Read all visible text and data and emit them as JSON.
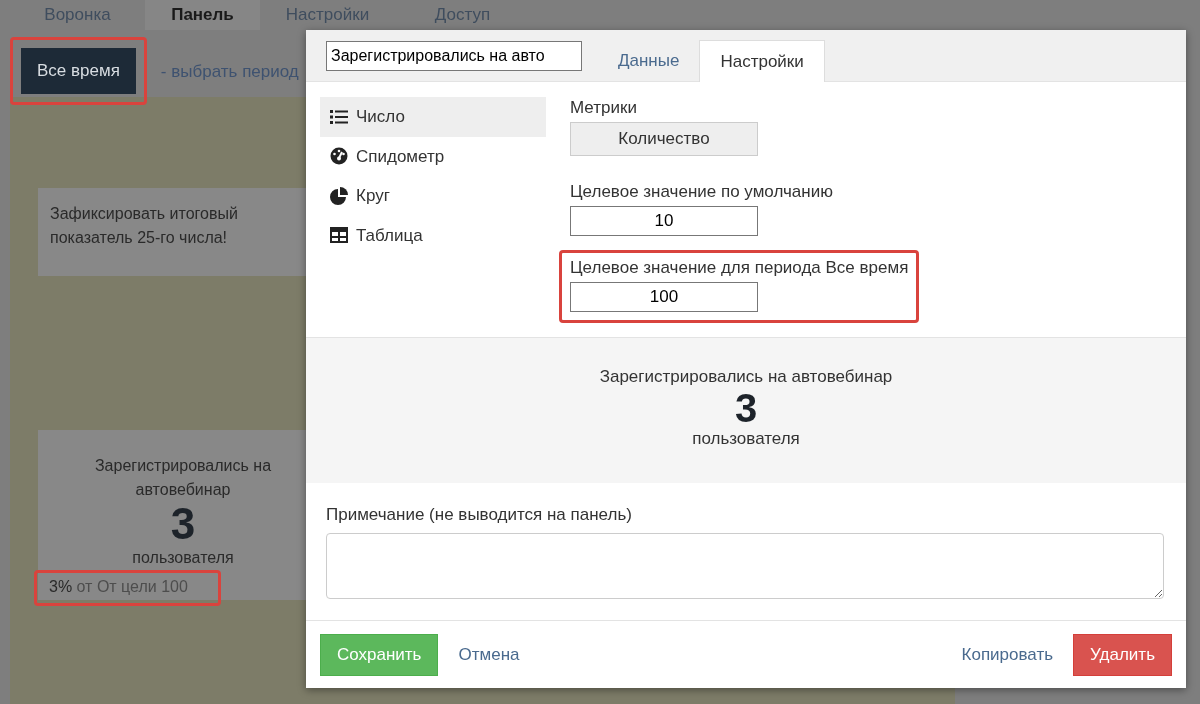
{
  "page_tabs": [
    {
      "label": "Воронка",
      "selected": false
    },
    {
      "label": "Панель",
      "selected": true
    },
    {
      "label": "Настройки",
      "selected": false
    },
    {
      "label": "Доступ",
      "selected": false
    }
  ],
  "period_button": {
    "label": "Все время",
    "highlighted": true
  },
  "period_link": "- выбрать период",
  "note_card": {
    "text": "Зафиксировать итоговый показатель 25-го числа!"
  },
  "metric_card": {
    "title": "Зарегистрировались на автовебинар",
    "value": "3",
    "unit": "пользователя",
    "progress": "**3%** от От цели 100",
    "highlighted": true
  },
  "modal": {
    "title_value": "Зарегистрировались на авто",
    "tabs": [
      {
        "label": "Данные",
        "selected": false
      },
      {
        "label": "Настройки",
        "selected": true
      }
    ],
    "widget_types": [
      {
        "label": "Число",
        "selected": true
      },
      {
        "label": "Спидометр",
        "selected": false
      },
      {
        "label": "Круг",
        "selected": false
      },
      {
        "label": "Таблица",
        "selected": false
      }
    ],
    "metrics_label": "Метрики",
    "metrics_button": "Количество",
    "fields": [
      {
        "label": "Целевое значение по умолчанию",
        "value": "10",
        "highlighted": false
      },
      {
        "label": "Целевое значение для периода Все время",
        "value": "100",
        "highlighted": true
      }
    ],
    "preview": {
      "title": "Зарегистрировались на автовебинар",
      "value": "3",
      "unit": "пользователя"
    },
    "note_label": "Примечание (не выводится на панель)",
    "buttons": [
      {
        "label": "Сохранить",
        "kind": "success"
      },
      {
        "label": "Отмена",
        "kind": "link"
      },
      {
        "label": "Копировать",
        "kind": "link"
      },
      {
        "label": "Удалить",
        "kind": "danger"
      }
    ]
  }
}
